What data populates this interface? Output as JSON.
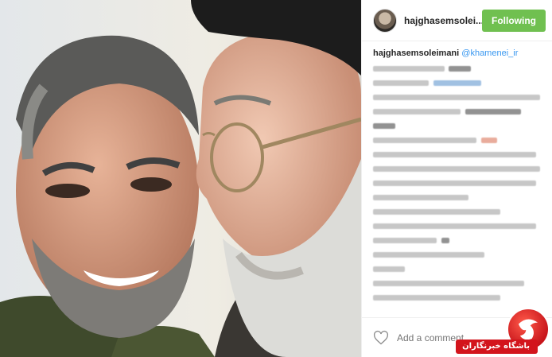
{
  "post": {
    "username": "hajghasemsolei...",
    "follow_label": "Following",
    "caption_user": "hajghasemsoleimani",
    "caption_mention": "@khamenei_ir",
    "comment_placeholder": "Add a comment...",
    "colors": {
      "follow": "#70c050",
      "mention": "#3897f0",
      "watermark": "#d3141c"
    }
  },
  "watermark": {
    "site_name": "باشگاه خبرنگاران"
  },
  "icons": [
    "heart-icon",
    "avatar",
    "watermark-logo-icon"
  ]
}
